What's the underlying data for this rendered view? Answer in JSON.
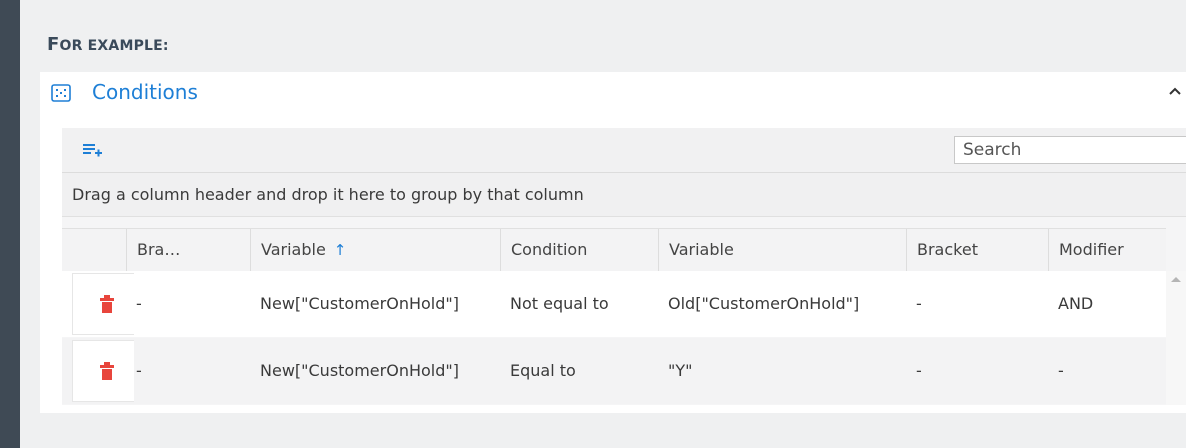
{
  "heading": {
    "first": "F",
    "rest": "OR EXAMPLE:"
  },
  "panel": {
    "title": "Conditions",
    "icon": "conditions-icon",
    "collapse_icon": "chevron-up-icon",
    "accent_color": "#1e7fd6"
  },
  "toolbar": {
    "add_icon": "add-row-icon",
    "search_placeholder": "Search"
  },
  "group_panel_text": "Drag a column header and drop it here to group by that column",
  "columns": [
    "Bra…",
    "Variable",
    "Condition",
    "Variable",
    "Bracket",
    "Modifier"
  ],
  "sort": {
    "column_index": 1,
    "icon": "sort-ascending-icon",
    "symbol": "↑"
  },
  "rows": [
    {
      "bracket1": "-",
      "variable1": "New[\"CustomerOnHold\"]",
      "condition": "Not equal to",
      "variable2": "Old[\"CustomerOnHold\"]",
      "bracket2": "-",
      "modifier": "AND"
    },
    {
      "bracket1": "-",
      "variable1": "New[\"CustomerOnHold\"]",
      "condition": "Equal to",
      "variable2": "\"Y\"",
      "bracket2": "-",
      "modifier": "-"
    }
  ],
  "delete_icon": "trash-icon",
  "delete_color": "#e8453c"
}
